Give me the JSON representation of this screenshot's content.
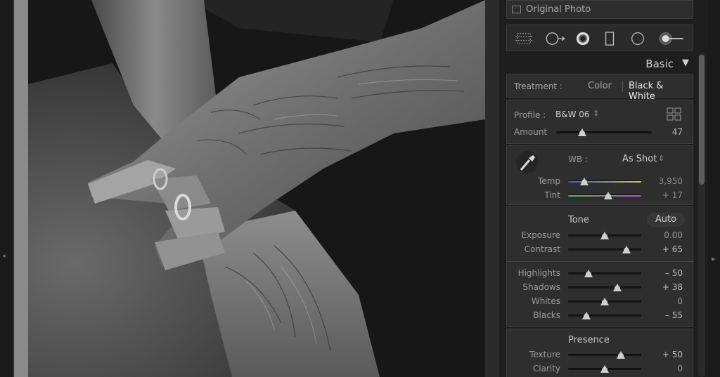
{
  "panel": {
    "original_photo_label": "Original Photo",
    "basic_title": "Basic",
    "basic_toggle": "▼",
    "treatment": {
      "label": "Treatment :",
      "options": [
        "Color",
        "Black & White"
      ],
      "selected": "Black & White"
    },
    "profile": {
      "label": "Profile :",
      "value": "B&W 06",
      "chevron": "⇕"
    },
    "amount": {
      "label": "Amount",
      "value": "47",
      "fraction": 0.27
    },
    "wb": {
      "label": "WB :",
      "value": "As Shot",
      "chevron": "⇕"
    },
    "temp": {
      "label": "Temp",
      "value": "3,950",
      "fraction": 0.22
    },
    "tint": {
      "label": "Tint",
      "value": "+ 17",
      "fraction": 0.55
    },
    "tone": {
      "label": "Tone",
      "auto_label": "Auto"
    },
    "exposure": {
      "label": "Exposure",
      "value": "0.00",
      "fraction": 0.5
    },
    "contrast": {
      "label": "Contrast",
      "value": "+ 65",
      "fraction": 0.8
    },
    "highlights": {
      "label": "Highlights",
      "value": "– 50",
      "fraction": 0.28
    },
    "shadows": {
      "label": "Shadows",
      "value": "+ 38",
      "fraction": 0.67
    },
    "whites": {
      "label": "Whites",
      "value": "0",
      "fraction": 0.5
    },
    "blacks": {
      "label": "Blacks",
      "value": "– 55",
      "fraction": 0.25
    },
    "presence": {
      "label": "Presence"
    },
    "texture": {
      "label": "Texture",
      "value": "+ 50",
      "fraction": 0.72
    },
    "clarity": {
      "label": "Clarity",
      "value": "0",
      "fraction": 0.5
    }
  },
  "colors": {
    "panel_bg": "#2e2e2e",
    "text": "#bdbdbd",
    "temp_gradient": [
      "#3a5cc9",
      "#d8c84a"
    ],
    "tint_gradient": [
      "#3fbf4a",
      "#c44ad4"
    ]
  },
  "icons": {
    "tools": [
      "crop-overlay-icon",
      "spot-removal-icon",
      "red-eye-icon",
      "graduated-filter-icon",
      "radial-filter-icon",
      "adjustment-brush-icon"
    ],
    "eyedropper": "eyedropper-icon",
    "profile_browser": "grid-icon",
    "left_panel_toggle": "left-panel-arrow-icon",
    "right_panel_toggle": "right-panel-arrow-icon"
  }
}
